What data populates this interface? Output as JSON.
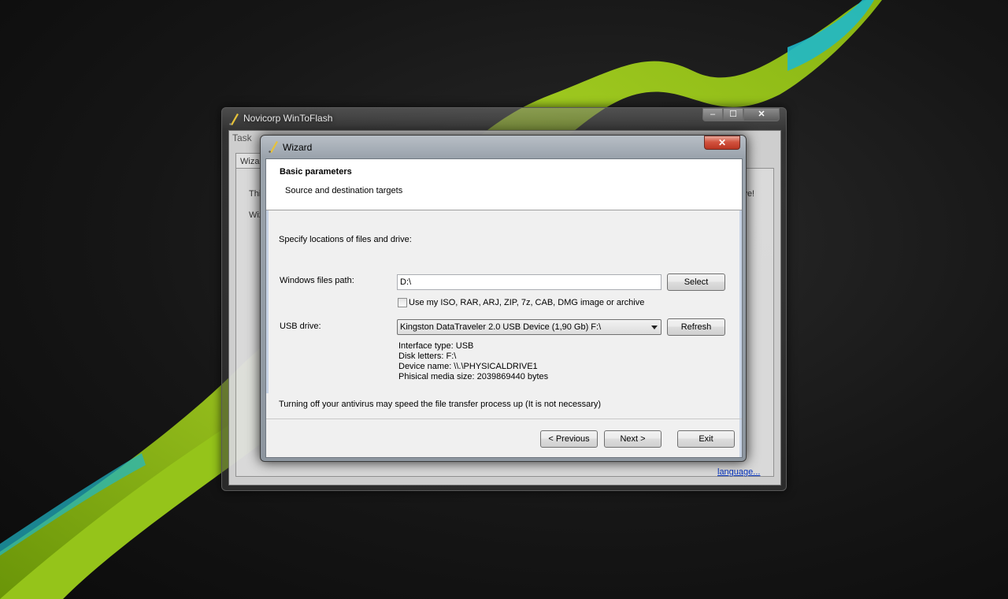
{
  "main_window": {
    "title": "Novicorp WinToFlash",
    "menu_task": "Task",
    "tab_wizard": "Wizar",
    "frag_this": "Thi",
    "frag_wiz": "Wiz",
    "frag_right": "ive!",
    "link_language": "language..."
  },
  "caption_buttons": {
    "minimize": "–",
    "maximize": "☐",
    "close": "✕"
  },
  "wizard": {
    "title": "Wizard",
    "close": "✕",
    "header": {
      "title": "Basic parameters",
      "subtitle": "Source and destination targets"
    },
    "instruction": "Specify locations of files and drive:",
    "windows_files_label": "Windows files path:",
    "windows_files_value": "D:\\",
    "select_button": "Select",
    "archive_checkbox_label": "Use my ISO, RAR, ARJ, ZIP, 7z, CAB, DMG image or archive",
    "archive_checked": false,
    "usb_label": "USB drive:",
    "usb_selected": "Kingston DataTraveler 2.0 USB Device (1,90 Gb) F:\\",
    "refresh_button": "Refresh",
    "drive_info": [
      "Interface type: USB",
      "Disk letters: F:\\",
      "Device name: \\\\.\\PHYSICALDRIVE1",
      "Phisical media size: 2039869440 bytes"
    ],
    "antivirus_note": "Turning off your antivirus may speed the file transfer process up (It is not necessary)",
    "previous_button": "< Previous",
    "next_button": "Next >",
    "exit_button": "Exit"
  },
  "colors": {
    "accent_green": "#a8d41c",
    "accent_cyan": "#1fb8c9",
    "close_red": "#c8412c"
  }
}
